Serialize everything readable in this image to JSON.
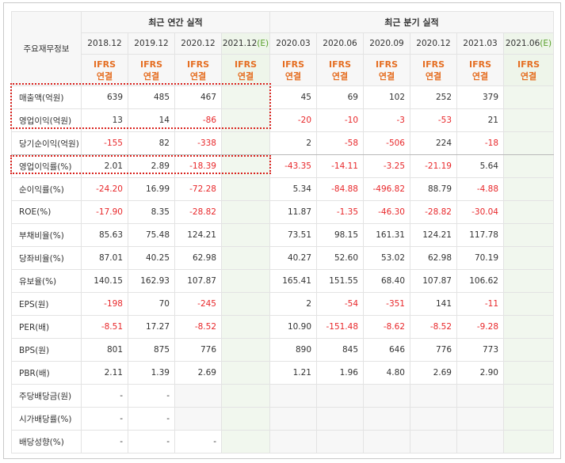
{
  "header": {
    "row_label": "주요재무정보",
    "annual_title": "최근 연간 실적",
    "quarterly_title": "최근 분기 실적",
    "estimate_marker": "(E)",
    "periods": [
      {
        "label": "2018.12",
        "estimate": false
      },
      {
        "label": "2019.12",
        "estimate": false
      },
      {
        "label": "2020.12",
        "estimate": false
      },
      {
        "label": "2021.12",
        "estimate": true
      },
      {
        "label": "2020.03",
        "estimate": false
      },
      {
        "label": "2020.06",
        "estimate": false
      },
      {
        "label": "2020.09",
        "estimate": false
      },
      {
        "label": "2020.12",
        "estimate": false
      },
      {
        "label": "2021.03",
        "estimate": false
      },
      {
        "label": "2021.06",
        "estimate": true
      }
    ],
    "ifrs_line1": "IFRS",
    "ifrs_line2": "연결"
  },
  "rows": [
    {
      "label": "매출액(억원)",
      "values": [
        "639",
        "485",
        "467",
        "",
        "45",
        "69",
        "102",
        "252",
        "379",
        ""
      ]
    },
    {
      "label": "영업이익(억원)",
      "values": [
        "13",
        "14",
        "-86",
        "",
        "-20",
        "-10",
        "-3",
        "-53",
        "21",
        ""
      ]
    },
    {
      "label": "당기순이익(억원)",
      "values": [
        "-155",
        "82",
        "-338",
        "",
        "2",
        "-58",
        "-506",
        "224",
        "-18",
        ""
      ]
    },
    {
      "label": "영업이익률(%)",
      "values": [
        "2.01",
        "2.89",
        "-18.39",
        "",
        "-43.35",
        "-14.11",
        "-3.25",
        "-21.19",
        "5.64",
        ""
      ]
    },
    {
      "label": "순이익률(%)",
      "values": [
        "-24.20",
        "16.99",
        "-72.28",
        "",
        "5.34",
        "-84.88",
        "-496.82",
        "88.79",
        "-4.88",
        ""
      ]
    },
    {
      "label": "ROE(%)",
      "values": [
        "-17.90",
        "8.35",
        "-28.82",
        "",
        "11.87",
        "-1.35",
        "-46.30",
        "-28.82",
        "-30.04",
        ""
      ]
    },
    {
      "label": "부채비율(%)",
      "values": [
        "85.63",
        "75.48",
        "124.21",
        "",
        "73.51",
        "98.15",
        "161.31",
        "124.21",
        "117.78",
        ""
      ]
    },
    {
      "label": "당좌비율(%)",
      "values": [
        "87.01",
        "40.25",
        "62.98",
        "",
        "40.27",
        "52.60",
        "53.02",
        "62.98",
        "70.19",
        ""
      ]
    },
    {
      "label": "유보율(%)",
      "values": [
        "140.15",
        "162.93",
        "107.87",
        "",
        "165.41",
        "151.55",
        "68.40",
        "107.87",
        "106.62",
        ""
      ]
    },
    {
      "label": "EPS(원)",
      "values": [
        "-198",
        "70",
        "-245",
        "",
        "2",
        "-54",
        "-351",
        "141",
        "-11",
        ""
      ]
    },
    {
      "label": "PER(배)",
      "values": [
        "-8.51",
        "17.27",
        "-8.52",
        "",
        "10.90",
        "-151.48",
        "-8.62",
        "-8.52",
        "-9.28",
        ""
      ]
    },
    {
      "label": "BPS(원)",
      "values": [
        "801",
        "875",
        "776",
        "",
        "890",
        "845",
        "646",
        "776",
        "773",
        ""
      ]
    },
    {
      "label": "PBR(배)",
      "values": [
        "2.11",
        "1.39",
        "2.69",
        "",
        "1.21",
        "1.96",
        "4.80",
        "2.69",
        "2.90",
        ""
      ]
    },
    {
      "label": "주당배당금(원)",
      "values": [
        "-",
        "-",
        "",
        "",
        "",
        "",
        "",
        "",
        "",
        ""
      ]
    },
    {
      "label": "시가배당률(%)",
      "values": [
        "-",
        "-",
        "",
        "",
        "",
        "",
        "",
        "",
        "",
        ""
      ]
    },
    {
      "label": "배당성향(%)",
      "values": [
        "-",
        "-",
        "-",
        "",
        "",
        "",
        "",
        "",
        "",
        ""
      ]
    }
  ],
  "colors": {
    "negative": "#e8272a",
    "ifrs": "#e56e22",
    "estimate_bg": "#f1f7ee",
    "highlight": "#d9231e"
  }
}
